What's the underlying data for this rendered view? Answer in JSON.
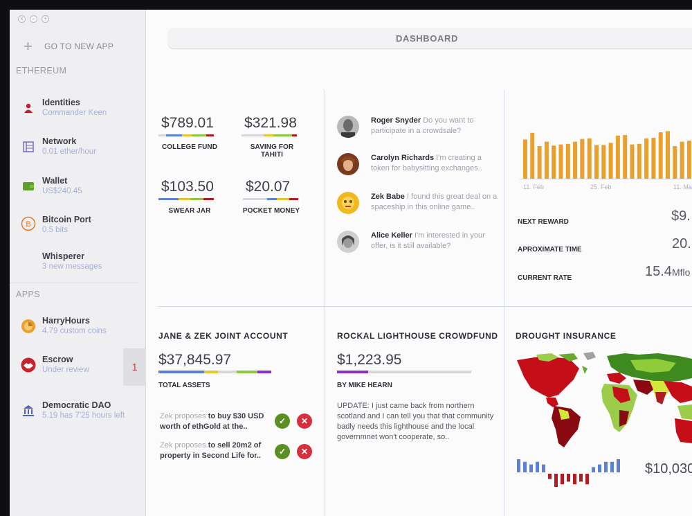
{
  "window_controls": [
    "x",
    "–",
    "+"
  ],
  "sidebar": {
    "new_app": {
      "icon": "plus-icon",
      "label": "GO TO NEW APP"
    },
    "ethereum_title": "ETHEREUM",
    "apps_title": "APPS",
    "items": [
      {
        "title": "Identities",
        "subtitle": "Commander Keen",
        "icon": "user-icon"
      },
      {
        "title": "Network",
        "subtitle": "0.01 ether/hour",
        "icon": "network-icon"
      },
      {
        "title": "Wallet",
        "subtitle": "US$240.45",
        "icon": "wallet-icon"
      },
      {
        "title": "Bitcoin Port",
        "subtitle": "0.5 bits",
        "icon": "bitcoin-icon"
      },
      {
        "title": "Whisperer",
        "subtitle": "3 new messages",
        "icon": ""
      },
      {
        "title": "HarryHours",
        "subtitle": "4.79 custom coins",
        "icon": "harryhours-icon"
      },
      {
        "title": "Escrow",
        "subtitle": "Under review",
        "icon": "handshake-icon"
      },
      {
        "title": "Democratic DAO",
        "subtitle": "5.19 has 7'25 hours left",
        "icon": "capitol-icon"
      }
    ],
    "escrow_badge": "1"
  },
  "header": {
    "title": "DASHBOARD"
  },
  "funds": [
    {
      "amount": "$789.01",
      "label": "COLLEGE FUND"
    },
    {
      "amount": "$321.98",
      "label": "SAVING FOR TAHITI"
    },
    {
      "amount": "$103.50",
      "label": "SWEAR JAR"
    },
    {
      "amount": "$20.07",
      "label": "POCKET MONEY"
    }
  ],
  "messages": [
    {
      "name": "Roger Snyder",
      "text": "Do you want to participate in a crowdsale?"
    },
    {
      "name": "Carolyn Richards",
      "text": "I'm creating a token for babysitting exchanges.."
    },
    {
      "name": "Zek Babe",
      "text": "I found this great deal on a spaceship in this online game.."
    },
    {
      "name": "Alice Keller",
      "text": "I'm interested in your offer, is it still available?"
    }
  ],
  "mining": {
    "x_ticks": [
      "11. Feb",
      "25. Feb",
      "11. Ma"
    ],
    "stats": [
      {
        "label": "NEXT REWARD",
        "value": "$9.",
        "unit": ""
      },
      {
        "label": "APROXIMATE TIME",
        "value": "20.",
        "unit": ""
      },
      {
        "label": "CURRENT RATE",
        "value": "15.4",
        "unit": "Mflo"
      }
    ]
  },
  "joint_account": {
    "title": "JANE & ZEK JOINT ACCOUNT",
    "amount": "$37,845.97",
    "label": "TOTAL ASSETS",
    "proposals": [
      {
        "who": "Zek proposes",
        "action": "to buy $30 USD worth of ethGold at the.."
      },
      {
        "who": "Zek proposes",
        "action": "to sell 20m2 of property in Second Life for.."
      }
    ]
  },
  "crowdfund": {
    "title": "ROCKAL LIGHTHOUSE CROWDFUND",
    "amount": "$1,223.95",
    "progress": 0.23,
    "byline": "BY MIKE HEARN",
    "update": "UPDATE: I just came back from northern scotland and I can tell you that that community badly needs this lighthouse and the local governmnet won't cooperate, so.."
  },
  "insurance": {
    "title": "DROUGHT INSURANCE",
    "amount": "$10,030"
  },
  "chart_data": [
    {
      "type": "bar",
      "x_ticks": [
        "11. Feb",
        "25. Feb",
        "11. Ma"
      ],
      "values": [
        72,
        84,
        60,
        68,
        61,
        63,
        64,
        68,
        73,
        74,
        62,
        62,
        66,
        79,
        80,
        63,
        64,
        74,
        75,
        85,
        87,
        60,
        68,
        70,
        62,
        61,
        76,
        90,
        73,
        62,
        68,
        72,
        64,
        71,
        82,
        71,
        70,
        75,
        78,
        83
      ],
      "color": "#e9a02d",
      "title": "",
      "xlabel": "",
      "ylabel": ""
    },
    {
      "type": "bar",
      "values": [
        5,
        4,
        3,
        4,
        3,
        -2,
        -5,
        -4,
        -3,
        -4,
        -3,
        -4,
        2,
        3,
        4,
        4,
        5
      ],
      "colors": {
        "positive": "#5b80d6",
        "negative": "#b01c24"
      },
      "title": "",
      "xlabel": "",
      "ylabel": ""
    }
  ],
  "colors": {
    "ok": "#5b8f22",
    "reject": "#d6303e",
    "accent_blue": "#5b80d6",
    "purple": "#8e2fc8",
    "orange": "#e9a02d"
  }
}
